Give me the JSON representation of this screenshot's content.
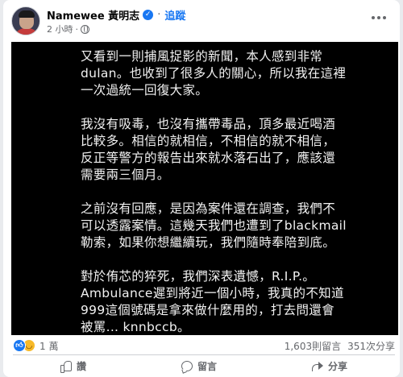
{
  "post": {
    "author": "Namewee 黃明志",
    "follow_label": "追蹤",
    "time": "2 小時",
    "separator": "·",
    "image_paragraphs": [
      "又看到一則捕風捉影的新聞，本人感到非常dulan。也收到了很多人的關心，所以我在這裡一次過統一回復大家。",
      "我沒有吸毒，也沒有攜帶毒品，頂多最近喝酒比較多。相信的就相信，不相信的就不相信，反正等警方的報告出來就水落石出了，應該還需要兩三個月。",
      "之前沒有回應，是因為案件還在調查，我們不可以透露案情。這幾天我們也遭到了blackmail勒索，如果你想繼續玩，我們隨時奉陪到底。",
      "對於侑芯的猝死，我們深表遺憾，R.I.P.。Ambulance遲到將近一個小時，我真的不知道999這個號碼是拿來做什麼用的，打去問還會被罵... knnbccb。"
    ]
  },
  "reactions": {
    "count": "1 萬",
    "comments": "1,603則留言",
    "shares": "351次分享"
  },
  "actions": {
    "like": "讚",
    "comment": "留言",
    "share": "分享"
  },
  "colors": {
    "accent": "#1877f2",
    "image_bg": "#000000",
    "muted_text": "#65676b"
  },
  "icons": [
    "verified-icon",
    "globe-icon",
    "more-icon",
    "like-reaction-icon",
    "haha-reaction-icon",
    "like-icon",
    "comment-icon",
    "share-icon"
  ]
}
